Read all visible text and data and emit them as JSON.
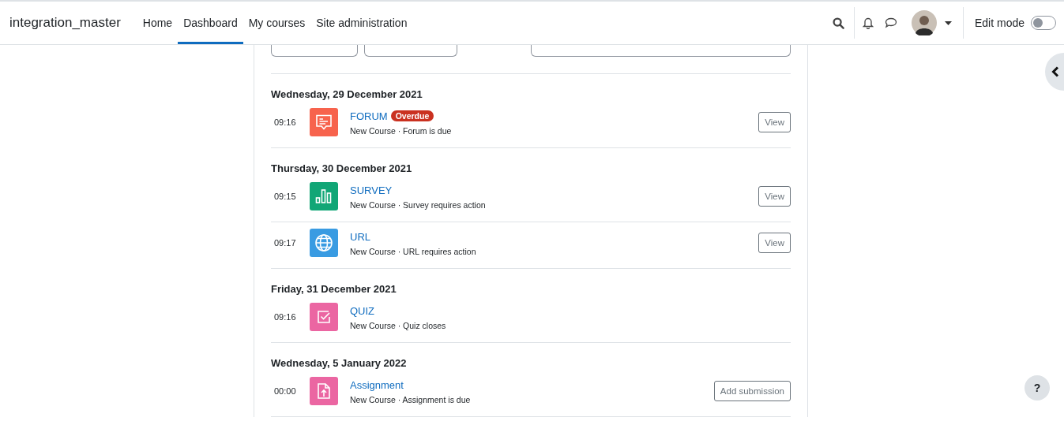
{
  "navbar": {
    "brand": "integration_master",
    "nav_items": [
      {
        "label": "Home",
        "selected": false
      },
      {
        "label": "Dashboard",
        "selected": true
      },
      {
        "label": "My courses",
        "selected": false
      },
      {
        "label": "Site administration",
        "selected": false
      }
    ],
    "edit_mode": {
      "label": "Edit mode",
      "on": false
    }
  },
  "days": [
    {
      "date": "Wednesday, 29 December 2021",
      "events": [
        {
          "time": "09:16",
          "kind": "forum",
          "color": "#f7634d",
          "title": "FORUM",
          "badge": "Overdue",
          "description": "New Course · Forum is due",
          "action": "View"
        }
      ]
    },
    {
      "date": "Thursday, 30 December 2021",
      "events": [
        {
          "time": "09:15",
          "kind": "survey",
          "color": "#11a676",
          "title": "SURVEY",
          "description": "New Course · Survey requires action",
          "action": "View"
        },
        {
          "time": "09:17",
          "kind": "url",
          "color": "#399be2",
          "title": "URL",
          "description": "New Course · URL requires action",
          "action": "View"
        }
      ]
    },
    {
      "date": "Friday, 31 December 2021",
      "events": [
        {
          "time": "09:16",
          "kind": "quiz",
          "color": "#eb66a2",
          "title": "QUIZ",
          "description": "New Course · Quiz closes"
        }
      ]
    },
    {
      "date": "Wednesday, 5 January 2022",
      "events": [
        {
          "time": "00:00",
          "kind": "assign",
          "color": "#eb66a2",
          "title": "Assignment",
          "description": "New Course · Assignment is due",
          "action": "Add submission"
        }
      ]
    }
  ],
  "help_button": "?"
}
